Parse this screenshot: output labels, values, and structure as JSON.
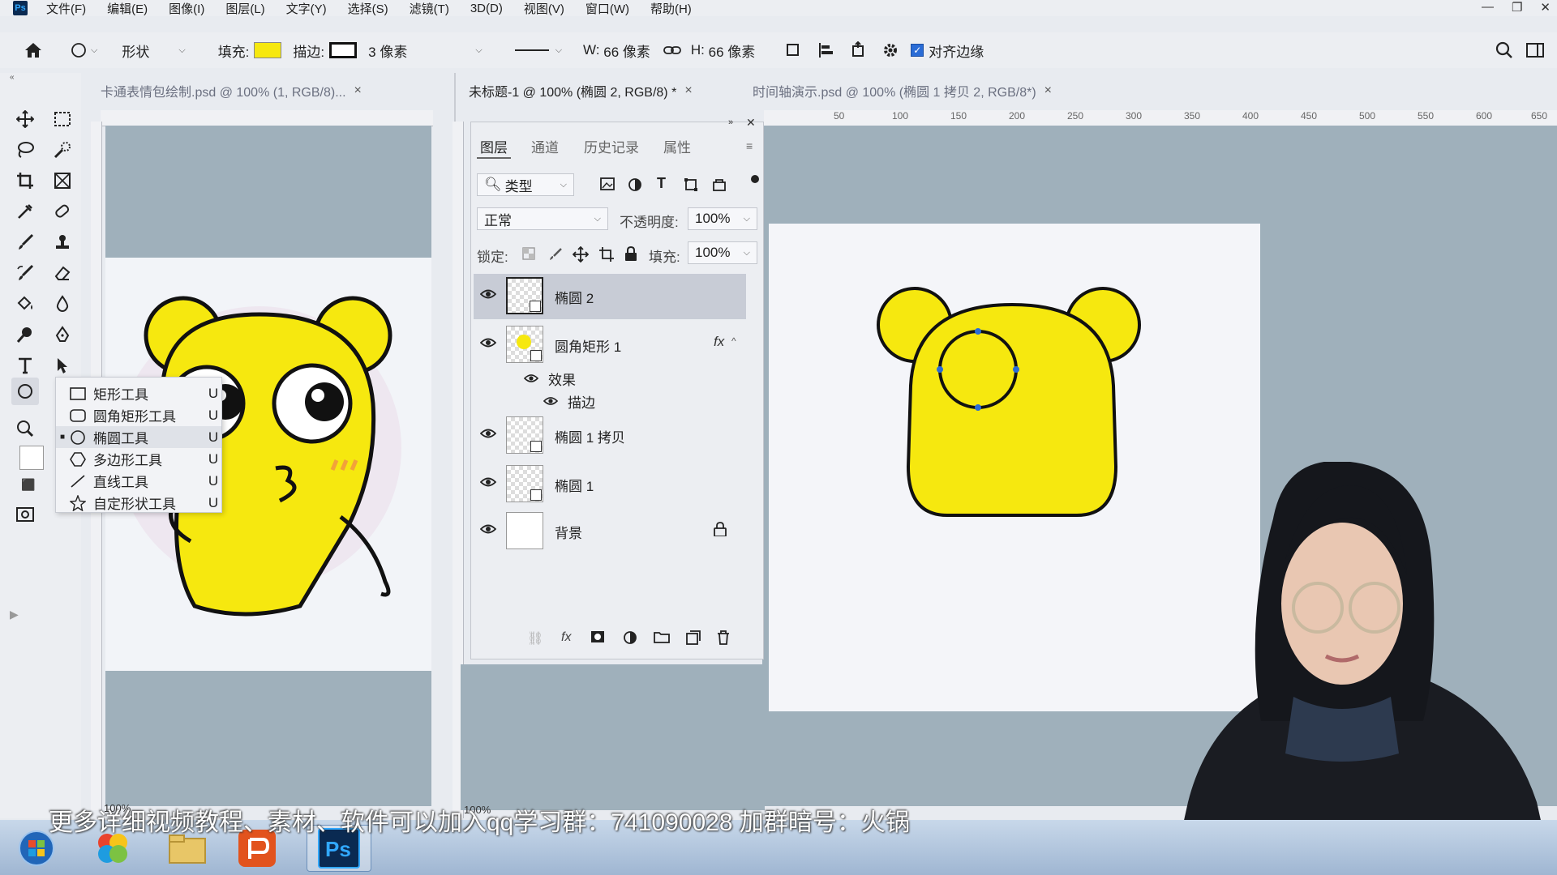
{
  "app": {
    "logo": "Ps",
    "name": "Adobe Photoshop"
  },
  "menu": [
    "文件(F)",
    "编辑(E)",
    "图像(I)",
    "图层(L)",
    "文字(Y)",
    "选择(S)",
    "滤镜(T)",
    "3D(D)",
    "视图(V)",
    "窗口(W)",
    "帮助(H)"
  ],
  "window_controls": [
    "—",
    "❐",
    "✕"
  ],
  "options": {
    "mode_label": "形状",
    "fill_label": "填充:",
    "fill_color": "#f6e80f",
    "stroke_label": "描边:",
    "stroke_size": "3 像素",
    "w_label": "W:",
    "w_value": "66 像素",
    "h_label": "H:",
    "h_value": "66 像素",
    "align_edges_label": "对齐边缘"
  },
  "tabs": [
    {
      "title": "卡通表情包绘制.psd @ 100% (1, RGB/8)...",
      "close": "×"
    },
    {
      "title": "未标题-1 @ 100% (椭圆 2, RGB/8) *",
      "close": "×"
    },
    {
      "title": "时间轴演示.psd @ 100% (椭圆 1 拷贝 2, RGB/8*)",
      "close": "×"
    }
  ],
  "ruler_labels": [
    "50",
    "100",
    "150",
    "200",
    "250",
    "300",
    "350",
    "400",
    "450",
    "500",
    "550",
    "600",
    "650"
  ],
  "flyout": {
    "items": [
      {
        "icon": "rectangle-icon",
        "label": "矩形工具",
        "key": "U",
        "selected": false
      },
      {
        "icon": "rounded-rectangle-icon",
        "label": "圆角矩形工具",
        "key": "U",
        "selected": false
      },
      {
        "icon": "ellipse-icon",
        "label": "椭圆工具",
        "key": "U",
        "selected": true
      },
      {
        "icon": "polygon-icon",
        "label": "多边形工具",
        "key": "U",
        "selected": false
      },
      {
        "icon": "line-icon",
        "label": "直线工具",
        "key": "U",
        "selected": false
      },
      {
        "icon": "custom-shape-icon",
        "label": "自定形状工具",
        "key": "U",
        "selected": false
      }
    ]
  },
  "layers_panel": {
    "tabs": [
      "图层",
      "通道",
      "历史记录",
      "属性"
    ],
    "filter_label": "类型",
    "blend_mode": "正常",
    "opacity_label": "不透明度:",
    "opacity_value": "100%",
    "lock_label": "锁定:",
    "fill_label": "填充:",
    "fill_value": "100%",
    "layers": [
      {
        "name": "椭圆 2",
        "selected": true,
        "fx": false
      },
      {
        "name": "圆角矩形 1",
        "selected": false,
        "fx": true,
        "fx_label": "fx"
      },
      {
        "name": "椭圆 1 拷贝",
        "selected": false,
        "fx": false
      },
      {
        "name": "椭圆 1",
        "selected": false,
        "fx": false
      },
      {
        "name": "背景",
        "selected": false,
        "fx": false,
        "locked": true
      }
    ],
    "effects_label": "效果",
    "stroke_effect_label": "描边"
  },
  "zoom": {
    "doc1": "100%",
    "doc2": "100%"
  },
  "subtitle": "更多详细视频教程、素材、软件可以加入qq学习群：741090028 加群暗号：火锅",
  "taskbar_items": [
    "start",
    "browser",
    "file-explorer",
    "wps-presentation",
    "photoshop"
  ],
  "colors": {
    "accent_yellow": "#f6e80f",
    "canvas_grey": "#9fb0bb",
    "selection_blue": "#2a6cd6"
  }
}
